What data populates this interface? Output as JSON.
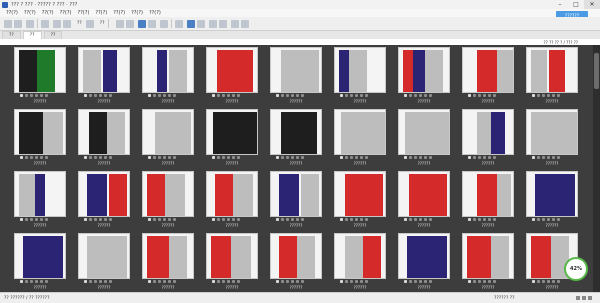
{
  "window": {
    "title": "??? ? ??? · ????? ? ??? · ???",
    "buttons": [
      "–",
      "□",
      "✕"
    ]
  },
  "menu": [
    "??(?)",
    "??(?)",
    "??(?)",
    "??(?)",
    "??(?)",
    "??(?)",
    "??(?)",
    "??(?)",
    "??(?)"
  ],
  "cloud_button": "??????",
  "toolbar": {
    "labels": [
      "??",
      "??"
    ]
  },
  "tabs": [
    "??",
    "??",
    "??"
  ],
  "info": "?? ?? ?? ? / ??? ??",
  "colors": {
    "red": "#d42a2a",
    "navy": "#2b2474",
    "green": "#1f7a2a",
    "black": "#1e1e1e",
    "gray": "#bdbdbd",
    "badge": "#57b847"
  },
  "items": [
    {
      "name": "??????",
      "pattern": [
        [
          "green",
          18,
          18,
          "black",
          0,
          18
        ]
      ]
    },
    {
      "name": "??????",
      "pattern": [
        [
          "gray",
          0,
          18,
          "navy",
          20,
          14
        ]
      ]
    },
    {
      "name": "??????",
      "pattern": [
        [
          "navy",
          10,
          10,
          "gray",
          22,
          18
        ]
      ]
    },
    {
      "name": "??????",
      "pattern": [
        [
          "red",
          6,
          18,
          "red",
          24,
          18
        ]
      ]
    },
    {
      "name": "??????",
      "pattern": [
        [
          "gray",
          6,
          38
        ]
      ]
    },
    {
      "name": "??????",
      "pattern": [
        [
          "navy",
          0,
          10,
          "gray",
          10,
          18
        ]
      ]
    },
    {
      "name": "??????",
      "pattern": [
        [
          "red",
          0,
          10,
          "navy",
          10,
          12,
          "gray",
          22,
          18
        ]
      ]
    },
    {
      "name": "??????",
      "pattern": [
        [
          "red",
          10,
          20,
          "gray",
          30,
          16
        ]
      ]
    },
    {
      "name": "??????",
      "pattern": [
        [
          "gray",
          0,
          16,
          "red",
          18,
          16
        ]
      ]
    },
    {
      "name": "??????",
      "pattern": [
        [
          "black",
          0,
          24,
          "gray",
          24,
          20
        ]
      ]
    },
    {
      "name": "??????",
      "pattern": [
        [
          "black",
          6,
          18,
          "gray",
          24,
          18
        ]
      ]
    },
    {
      "name": "??????",
      "pattern": [
        [
          "gray",
          8,
          36
        ]
      ]
    },
    {
      "name": "??????",
      "pattern": [
        [
          "black",
          2,
          44
        ]
      ]
    },
    {
      "name": "??????",
      "pattern": [
        [
          "black",
          6,
          36
        ]
      ]
    },
    {
      "name": "??????",
      "pattern": [
        [
          "gray",
          2,
          46
        ]
      ]
    },
    {
      "name": "??????",
      "pattern": [
        [
          "gray",
          2,
          46
        ]
      ]
    },
    {
      "name": "??????",
      "pattern": [
        [
          "gray",
          10,
          14,
          "navy",
          24,
          14
        ]
      ]
    },
    {
      "name": "??????",
      "pattern": [
        [
          "gray",
          0,
          52
        ]
      ]
    },
    {
      "name": "??????",
      "pattern": [
        [
          "gray",
          0,
          16,
          "navy",
          16,
          10
        ]
      ]
    },
    {
      "name": "??????",
      "pattern": [
        [
          "navy",
          4,
          20,
          "red",
          26,
          18
        ]
      ]
    },
    {
      "name": "??????",
      "pattern": [
        [
          "red",
          0,
          18,
          "gray",
          18,
          20
        ]
      ]
    },
    {
      "name": "??????",
      "pattern": [
        [
          "red",
          4,
          18,
          "gray",
          22,
          20
        ]
      ]
    },
    {
      "name": "??????",
      "pattern": [
        [
          "navy",
          4,
          20,
          "gray",
          26,
          18
        ]
      ]
    },
    {
      "name": "??????",
      "pattern": [
        [
          "red",
          6,
          38
        ]
      ]
    },
    {
      "name": "??????",
      "pattern": [
        [
          "red",
          6,
          38
        ]
      ]
    },
    {
      "name": "??????",
      "pattern": [
        [
          "red",
          10,
          20,
          "gray",
          30,
          14
        ]
      ]
    },
    {
      "name": "??????",
      "pattern": [
        [
          "navy",
          4,
          40
        ]
      ]
    },
    {
      "name": "??????",
      "pattern": [
        [
          "navy",
          4,
          40
        ]
      ]
    },
    {
      "name": "??????",
      "pattern": [
        [
          "gray",
          4,
          40
        ]
      ]
    },
    {
      "name": "??????",
      "pattern": [
        [
          "red",
          0,
          22,
          "gray",
          22,
          18
        ]
      ]
    },
    {
      "name": "??????",
      "pattern": [
        [
          "red",
          0,
          20,
          "gray",
          20,
          20
        ]
      ]
    },
    {
      "name": "??????",
      "pattern": [
        [
          "red",
          4,
          18,
          "gray",
          22,
          18
        ]
      ]
    },
    {
      "name": "??????",
      "pattern": [
        [
          "gray",
          6,
          18,
          "red",
          24,
          18
        ]
      ]
    },
    {
      "name": "??????",
      "pattern": [
        [
          "navy",
          4,
          40
        ]
      ]
    },
    {
      "name": "??????",
      "pattern": [
        [
          "red",
          0,
          24,
          "gray",
          24,
          18
        ]
      ]
    },
    {
      "name": "??????",
      "pattern": [
        [
          "red",
          0,
          20,
          "gray",
          20,
          18
        ]
      ]
    }
  ],
  "zoom": "42%",
  "status": {
    "left": "?? ?????? / ?? ??????",
    "right": "?????? ??"
  }
}
